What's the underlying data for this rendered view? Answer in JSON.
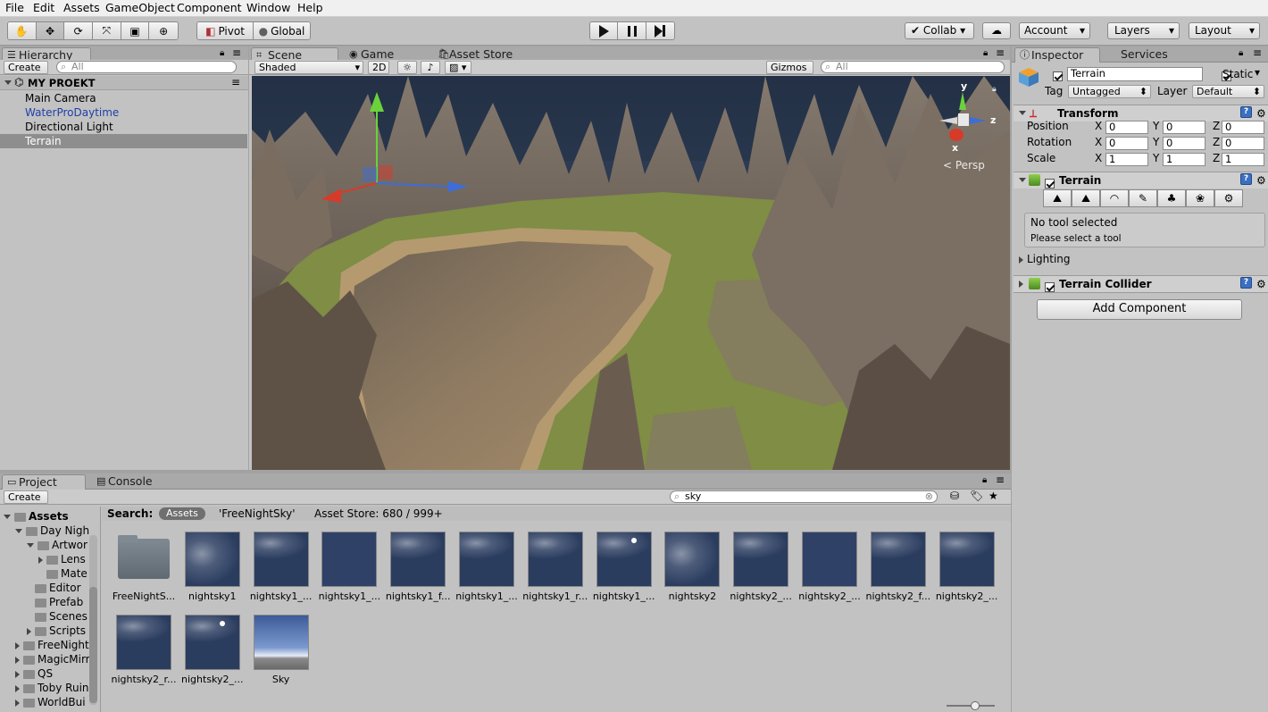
{
  "menu": [
    "File",
    "Edit",
    "Assets",
    "GameObject",
    "Component",
    "Window",
    "Help"
  ],
  "toolbar": {
    "pivot": "Pivot",
    "global": "Global",
    "collab": "Collab ▾",
    "account": "Account",
    "layers": "Layers",
    "layout": "Layout"
  },
  "hierarchy": {
    "tab": "Hierarchy",
    "create": "Create",
    "search_placeholder": "All",
    "scene_name": "MY PROEKT",
    "items": [
      {
        "label": "Main Camera",
        "color": "#000000",
        "selected": false
      },
      {
        "label": "WaterProDaytime",
        "color": "#1f3fa8",
        "selected": false
      },
      {
        "label": "Directional Light",
        "color": "#000000",
        "selected": false
      },
      {
        "label": "Terrain",
        "color": "#ffffff",
        "selected": true
      }
    ]
  },
  "scene": {
    "tabs": [
      "Scene",
      "Game",
      "Asset Store"
    ],
    "shading": "Shaded",
    "mode2d": "2D",
    "gizmos": "Gizmos",
    "search_placeholder": "All",
    "persp": "Persp",
    "gizmo_axes": {
      "x": "x",
      "y": "y",
      "z": "z"
    }
  },
  "inspector": {
    "tabs": [
      "Inspector",
      "Services"
    ],
    "object_name": "Terrain",
    "static_label": "Static",
    "tag_label": "Tag",
    "tag_value": "Untagged",
    "layer_label": "Layer",
    "layer_value": "Default",
    "transform": {
      "title": "Transform",
      "rows": [
        {
          "label": "Position",
          "x": "0",
          "y": "0",
          "z": "0"
        },
        {
          "label": "Rotation",
          "x": "0",
          "y": "0",
          "z": "0"
        },
        {
          "label": "Scale",
          "x": "1",
          "y": "1",
          "z": "1"
        }
      ]
    },
    "terrain": {
      "title": "Terrain",
      "tools": [
        "raise-lower-icon",
        "paint-height-icon",
        "smooth-height-icon",
        "paint-texture-icon",
        "place-trees-icon",
        "paint-details-icon",
        "terrain-settings-icon"
      ],
      "msg1": "No tool selected",
      "msg2": "Please select a tool"
    },
    "lighting": "Lighting",
    "collider": "Terrain Collider",
    "add_component": "Add Component"
  },
  "project": {
    "tabs": [
      "Project",
      "Console"
    ],
    "create": "Create",
    "search_value": "sky",
    "search_label": "Search:",
    "filter_assets": "Assets",
    "filter_free": "'FreeNightSky'",
    "asset_store": "Asset Store: 680 / 999+",
    "tree": [
      {
        "label": "Assets",
        "indent": 0,
        "open": true,
        "bold": true
      },
      {
        "label": "Day Nigh",
        "indent": 1,
        "open": true,
        "bold": false
      },
      {
        "label": "Artwor",
        "indent": 2,
        "open": true,
        "bold": false
      },
      {
        "label": "Lens",
        "indent": 3,
        "open": false,
        "bold": false
      },
      {
        "label": "Mate",
        "indent": 3,
        "open": null,
        "bold": false
      },
      {
        "label": "Editor",
        "indent": 2,
        "open": null,
        "bold": false
      },
      {
        "label": "Prefab",
        "indent": 2,
        "open": null,
        "bold": false
      },
      {
        "label": "Scenes",
        "indent": 2,
        "open": null,
        "bold": false
      },
      {
        "label": "Scripts",
        "indent": 2,
        "open": false,
        "bold": false
      },
      {
        "label": "FreeNight",
        "indent": 1,
        "open": false,
        "bold": false
      },
      {
        "label": "MagicMirr",
        "indent": 1,
        "open": false,
        "bold": false
      },
      {
        "label": "QS",
        "indent": 1,
        "open": false,
        "bold": false
      },
      {
        "label": "Toby Ruin",
        "indent": 1,
        "open": false,
        "bold": false
      },
      {
        "label": "WorldBui",
        "indent": 1,
        "open": false,
        "bold": false
      }
    ],
    "assets": [
      {
        "label": "FreeNightS...",
        "kind": "folder"
      },
      {
        "label": "nightsky1",
        "kind": "cloudy"
      },
      {
        "label": "nightsky1_...",
        "kind": "half"
      },
      {
        "label": "nightsky1_...",
        "kind": "plain"
      },
      {
        "label": "nightsky1_f...",
        "kind": "half"
      },
      {
        "label": "nightsky1_...",
        "kind": "half"
      },
      {
        "label": "nightsky1_r...",
        "kind": "half"
      },
      {
        "label": "nightsky1_...",
        "kind": "moon"
      },
      {
        "label": "nightsky2",
        "kind": "cloudy"
      },
      {
        "label": "nightsky2_...",
        "kind": "half"
      },
      {
        "label": "nightsky2_...",
        "kind": "plain"
      },
      {
        "label": "nightsky2_f...",
        "kind": "half"
      },
      {
        "label": "nightsky2_...",
        "kind": "half"
      },
      {
        "label": "nightsky2_r...",
        "kind": "half"
      },
      {
        "label": "nightsky2_...",
        "kind": "moon"
      },
      {
        "label": "Sky",
        "kind": "skybox"
      }
    ]
  }
}
